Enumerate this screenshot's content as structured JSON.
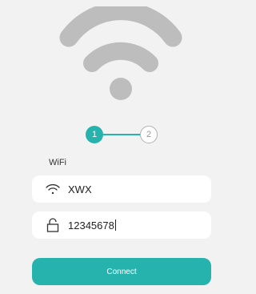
{
  "icons": {
    "hero": "wifi-icon",
    "ssid_field": "wifi-icon",
    "password_field": "lock-icon"
  },
  "colors": {
    "accent": "#27b3ad",
    "background": "#f2f2f2",
    "hero_gray": "#bdbdbd"
  },
  "steps": {
    "current": 1,
    "items": [
      {
        "label": "1",
        "state": "active"
      },
      {
        "label": "2",
        "state": "inactive"
      }
    ]
  },
  "form": {
    "section_label": "WiFi",
    "ssid_value": "XWX",
    "password_value": "12345678",
    "connect_label": "Connect"
  }
}
